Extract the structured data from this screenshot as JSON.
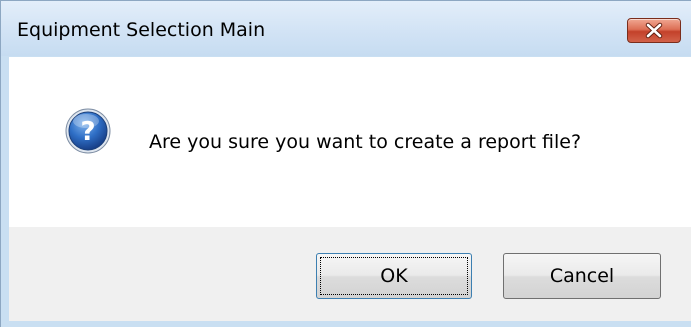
{
  "window": {
    "title": "Equipment Selection Main"
  },
  "titlebar": {
    "close_icon": "close-icon",
    "close_color": "#c7442c"
  },
  "dialog": {
    "icon": "question-icon",
    "message": "Are you sure you want to create a report file?"
  },
  "buttons": {
    "ok_label": "OK",
    "cancel_label": "Cancel"
  }
}
